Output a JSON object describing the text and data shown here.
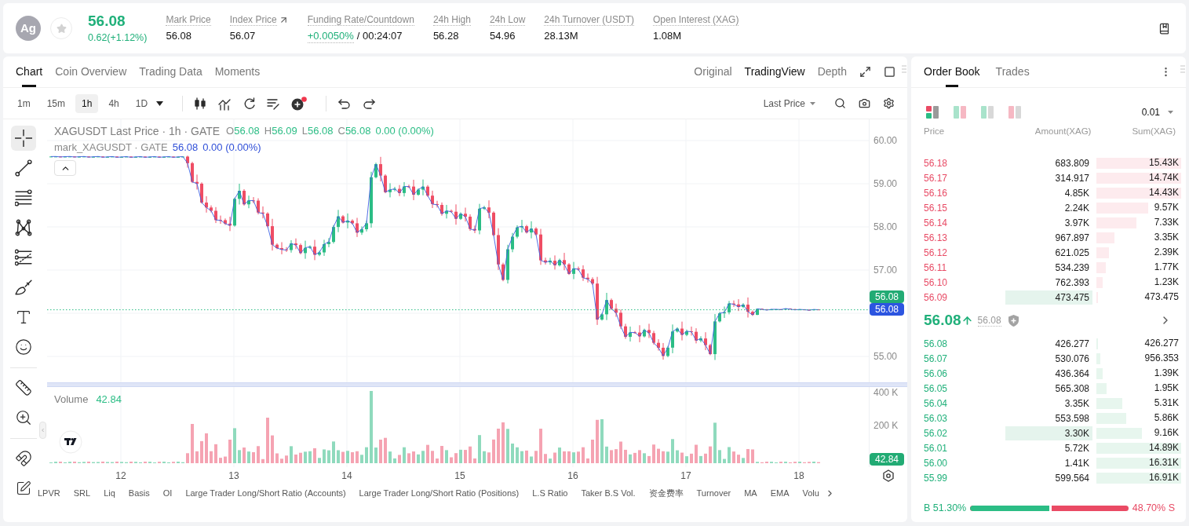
{
  "header": {
    "avatar": "Ag",
    "favorited": false,
    "price": "56.08",
    "change": "0.62(+1.12%)",
    "stats": [
      {
        "kind": "plain",
        "label": "Mark Price",
        "value": "56.08"
      },
      {
        "kind": "link",
        "label": "Index Price",
        "value": "56.07"
      },
      {
        "kind": "funding",
        "label": "Funding Rate/Countdown",
        "rate": "+0.0050%",
        "countdown": "/ 00:24:07"
      },
      {
        "kind": "plain",
        "label": "24h High",
        "value": "56.28"
      },
      {
        "kind": "plain",
        "label": "24h Low",
        "value": "54.96"
      },
      {
        "kind": "plain",
        "label": "24h Turnover (USDT)",
        "value": "28.13M"
      },
      {
        "kind": "plain",
        "label": "Open Interest (XAG)",
        "value": "1.08M"
      }
    ]
  },
  "chart_panel": {
    "tabs": [
      {
        "label": "Chart",
        "selected": true
      },
      {
        "label": "Coin Overview",
        "selected": false
      },
      {
        "label": "Trading Data",
        "selected": false
      },
      {
        "label": "Moments",
        "selected": false
      }
    ],
    "views": [
      {
        "label": "Original",
        "selected": false
      },
      {
        "label": "TradingView",
        "selected": true
      },
      {
        "label": "Depth",
        "selected": false
      }
    ],
    "intervals": [
      {
        "label": "1m",
        "selected": false
      },
      {
        "label": "15m",
        "selected": false
      },
      {
        "label": "1h",
        "selected": true
      },
      {
        "label": "4h",
        "selected": false
      },
      {
        "label": "1D",
        "selected": false
      }
    ],
    "tool_groups": [
      [
        {
          "kind": "candles",
          "badge": false
        },
        {
          "kind": "indicators",
          "badge": false
        },
        {
          "kind": "replay",
          "badge": false
        },
        {
          "kind": "templates",
          "badge": false
        },
        {
          "kind": "add",
          "badge": true
        }
      ],
      [
        {
          "kind": "undo",
          "badge": false
        },
        {
          "kind": "redo",
          "badge": false
        }
      ]
    ],
    "price_source": "Last Price",
    "drawing_tool_groups": [
      [
        {
          "kind": "crosshair",
          "selected": true
        },
        {
          "kind": "trend_line",
          "selected": false
        },
        {
          "kind": "parallel_lines",
          "selected": false
        },
        {
          "kind": "pattern",
          "selected": false
        },
        {
          "kind": "fib",
          "selected": false
        },
        {
          "kind": "brush",
          "selected": false
        },
        {
          "kind": "text",
          "selected": false
        },
        {
          "kind": "emoji",
          "selected": false
        }
      ],
      [
        {
          "kind": "ruler",
          "selected": false
        },
        {
          "kind": "zoom",
          "selected": false
        }
      ],
      [
        {
          "kind": "magnet",
          "selected": false
        },
        {
          "kind": "lock_draw",
          "selected": false
        }
      ]
    ],
    "legend": {
      "title": "XAGUSDT Last Price · 1h · GATE",
      "ohlc": [
        {
          "key": "O",
          "value": "56.08"
        },
        {
          "key": "H",
          "value": "56.09"
        },
        {
          "key": "L",
          "value": "56.08"
        },
        {
          "key": "C",
          "value": "56.08"
        }
      ],
      "change": "0.00 (0.00%)"
    },
    "mark_legend": {
      "title": "mark_XAGUSDT · GATE",
      "value": "56.08",
      "change": "0.00 (0.00%)"
    },
    "price_ticks": [
      "60.00",
      "59.00",
      "58.00",
      "57.00",
      "55.00"
    ],
    "last_price_tag": "56.08",
    "mark_price_tag": "56.08",
    "volume": {
      "label": "Volume",
      "value": "42.84",
      "ticks": [
        "400 K",
        "200 K"
      ],
      "tag": "42.84"
    },
    "dates": [
      "12",
      "13",
      "14",
      "15",
      "16",
      "17",
      "18"
    ],
    "indicators": [
      "LPVR",
      "SRL",
      "Liq",
      "Basis",
      "OI",
      "Large Trader Long/Short Ratio (Accounts)",
      "Large Trader Long/Short Ratio (Positions)",
      "L.S Ratio",
      "Taker B.S Vol.",
      "资金费率",
      "Turnover",
      "MA",
      "EMA",
      "Volu"
    ]
  },
  "order_book": {
    "tabs": [
      {
        "label": "Order Book",
        "selected": true
      },
      {
        "label": "Trades",
        "selected": false
      }
    ],
    "layouts": [
      {
        "kind": "both",
        "selected": true
      },
      {
        "kind": "split",
        "selected": false
      },
      {
        "kind": "bids",
        "selected": false
      },
      {
        "kind": "asks",
        "selected": false
      }
    ],
    "precision": "0.01",
    "columns": [
      "Price",
      "Amount(XAG)",
      "Sum(XAG)"
    ],
    "asks": [
      {
        "price": "56.18",
        "amount": "683.809",
        "sum": "15.43K",
        "level": 1.0,
        "highlighted": false
      },
      {
        "price": "56.17",
        "amount": "314.917",
        "sum": "14.74K",
        "level": 1.0,
        "highlighted": false
      },
      {
        "price": "56.16",
        "amount": "4.85K",
        "sum": "14.43K",
        "level": 1.0,
        "highlighted": false
      },
      {
        "price": "56.15",
        "amount": "2.24K",
        "sum": "9.57K",
        "level": 0.61,
        "highlighted": false
      },
      {
        "price": "56.14",
        "amount": "3.97K",
        "sum": "7.33K",
        "level": 0.47,
        "highlighted": false
      },
      {
        "price": "56.13",
        "amount": "967.897",
        "sum": "3.35K",
        "level": 0.21,
        "highlighted": false
      },
      {
        "price": "56.12",
        "amount": "621.025",
        "sum": "2.39K",
        "level": 0.15,
        "highlighted": false
      },
      {
        "price": "56.11",
        "amount": "534.239",
        "sum": "1.77K",
        "level": 0.11,
        "highlighted": false
      },
      {
        "price": "56.10",
        "amount": "762.393",
        "sum": "1.23K",
        "level": 0.07,
        "highlighted": false
      },
      {
        "price": "56.09",
        "amount": "473.475",
        "sum": "473.475",
        "level": 0.02,
        "highlighted": true
      }
    ],
    "last_price": "56.08",
    "rising": true,
    "mark_price": "56.08",
    "bids": [
      {
        "price": "56.08",
        "amount": "426.277",
        "sum": "426.277",
        "level": 0.02,
        "highlighted": false
      },
      {
        "price": "56.07",
        "amount": "530.076",
        "sum": "956.353",
        "level": 0.05,
        "highlighted": false
      },
      {
        "price": "56.06",
        "amount": "436.364",
        "sum": "1.39K",
        "level": 0.07,
        "highlighted": false
      },
      {
        "price": "56.05",
        "amount": "565.308",
        "sum": "1.95K",
        "level": 0.12,
        "highlighted": false
      },
      {
        "price": "56.04",
        "amount": "3.35K",
        "sum": "5.31K",
        "level": 0.31,
        "highlighted": false
      },
      {
        "price": "56.03",
        "amount": "553.598",
        "sum": "5.86K",
        "level": 0.35,
        "highlighted": false
      },
      {
        "price": "56.02",
        "amount": "3.30K",
        "sum": "9.16K",
        "level": 0.54,
        "highlighted": true
      },
      {
        "price": "56.01",
        "amount": "5.72K",
        "sum": "14.89K",
        "level": 1.0,
        "highlighted": false
      },
      {
        "price": "56.00",
        "amount": "1.41K",
        "sum": "16.31K",
        "level": 1.0,
        "highlighted": false
      },
      {
        "price": "55.99",
        "amount": "599.564",
        "sum": "16.91K",
        "level": 1.0,
        "highlighted": false
      }
    ],
    "buy_ratio": "B 51.30%",
    "sell_ratio": "48.70% S",
    "level": 0.513
  }
}
